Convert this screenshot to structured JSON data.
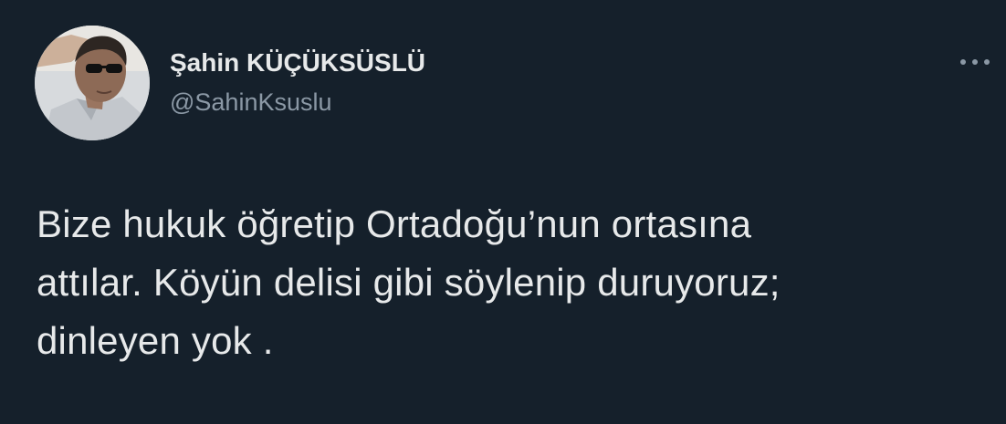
{
  "tweet": {
    "author": {
      "display_name": "Şahin KÜÇÜKSÜSLÜ",
      "handle": "@SahinKsuslu"
    },
    "more_icon": "more-horizontal-icon",
    "text": "Bize hukuk öğretip Ortadoğu’nun ortasına\nattılar. Köyün delisi gibi söylenip duruyoruz;\ndinleyen yok ."
  },
  "colors": {
    "background": "#15202b",
    "text_primary": "#e7e9ea",
    "text_secondary": "#8b98a5"
  }
}
